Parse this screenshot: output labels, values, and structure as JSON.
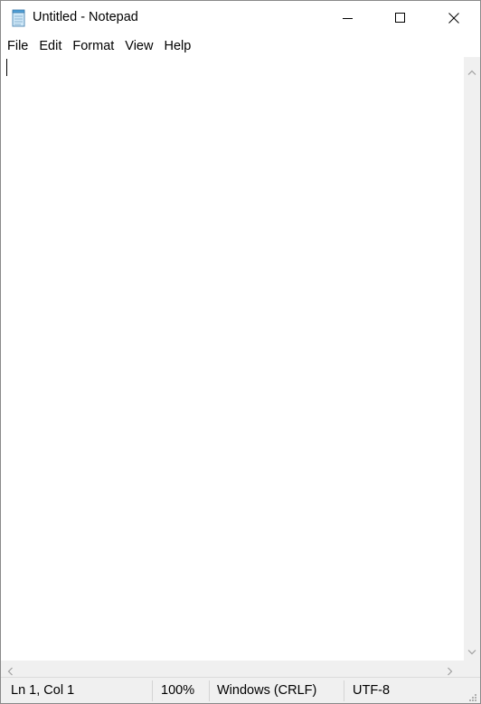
{
  "window": {
    "title": "Untitled - Notepad",
    "icon": "notepad-icon",
    "controls": {
      "minimize": "minimize-icon",
      "maximize": "maximize-icon",
      "close": "close-icon"
    }
  },
  "menu": {
    "items": [
      {
        "id": "file",
        "label": "File"
      },
      {
        "id": "edit",
        "label": "Edit"
      },
      {
        "id": "format",
        "label": "Format"
      },
      {
        "id": "view",
        "label": "View"
      },
      {
        "id": "help",
        "label": "Help"
      }
    ]
  },
  "editor": {
    "content": ""
  },
  "status": {
    "position": "Ln 1, Col 1",
    "zoom": "100%",
    "line_ending": "Windows (CRLF)",
    "encoding": "UTF-8"
  },
  "colors": {
    "chrome": "#f0f0f0",
    "background": "#ffffff",
    "text": "#000000"
  }
}
